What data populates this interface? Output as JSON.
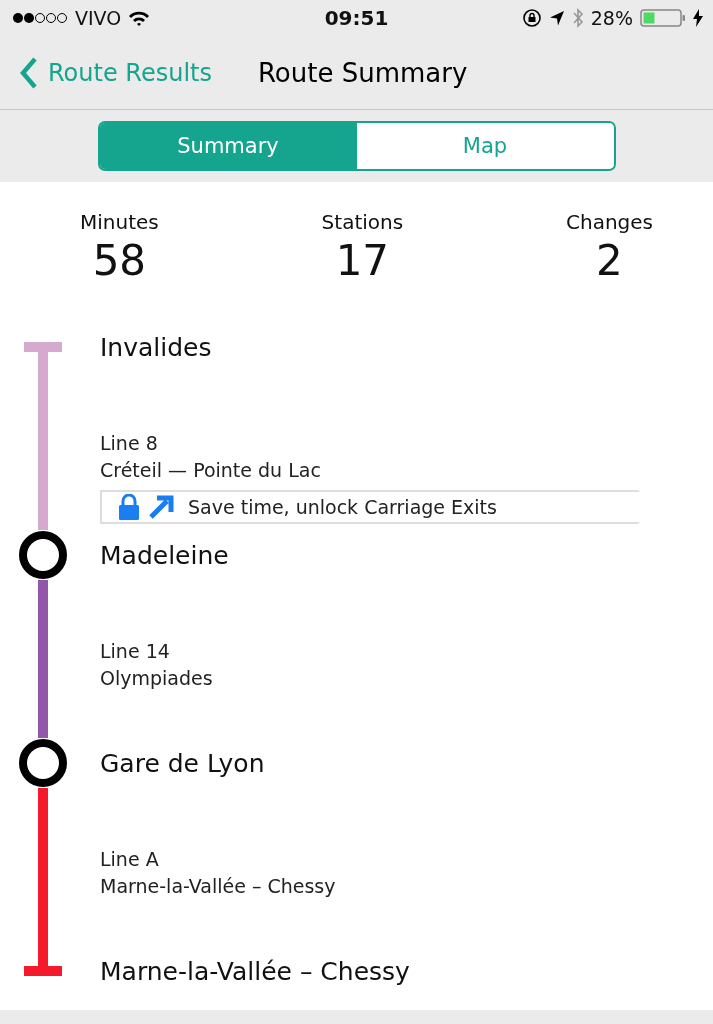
{
  "status_bar": {
    "carrier": "VIVO",
    "time": "09:51",
    "battery": "28%"
  },
  "nav": {
    "back": "Route Results",
    "title": "Route Summary"
  },
  "tabs": [
    {
      "label": "Summary",
      "selected": true
    },
    {
      "label": "Map",
      "selected": false
    }
  ],
  "stats": [
    {
      "label": "Minutes",
      "value": "58"
    },
    {
      "label": "Stations",
      "value": "17"
    },
    {
      "label": "Changes",
      "value": "2"
    }
  ],
  "route": [
    {
      "kind": "station",
      "name": "Invalides"
    },
    {
      "kind": "segment",
      "line": "Line 8",
      "direction": "Créteil — Pointe du Lac",
      "color": "#d6a9cf",
      "promo": "Save time, unlock Carriage Exits"
    },
    {
      "kind": "station",
      "name": "Madeleine"
    },
    {
      "kind": "segment",
      "line": "Line 14",
      "direction": "Olympiades",
      "color": "#9256ab"
    },
    {
      "kind": "station",
      "name": "Gare de Lyon"
    },
    {
      "kind": "segment",
      "line": "Line A",
      "direction": "Marne-la-Vallée – Chessy",
      "color": "#f41a2c"
    },
    {
      "kind": "station",
      "name": "Marne-la-Vallée – Chessy"
    }
  ]
}
